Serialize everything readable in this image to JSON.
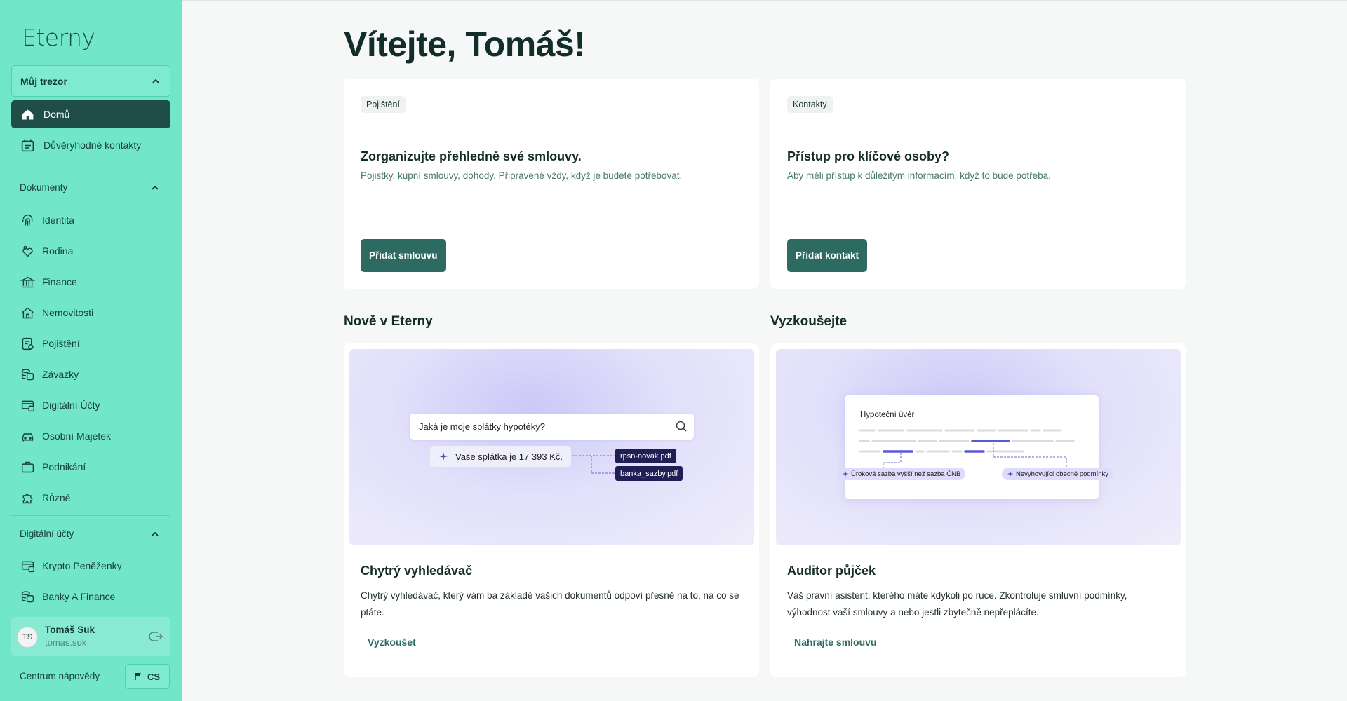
{
  "app": {
    "logo": "Eterny"
  },
  "sidebar": {
    "vault_label": "Můj trezor",
    "main_items": [
      {
        "label": "Domů",
        "icon": "home-icon",
        "active": true
      },
      {
        "label": "Důvěryhodné kontakty",
        "icon": "contacts-icon",
        "active": false
      }
    ],
    "documents_title": "Dokumenty",
    "documents": [
      {
        "label": "Identita",
        "icon": "fingerprint-icon"
      },
      {
        "label": "Rodina",
        "icon": "family-icon"
      },
      {
        "label": "Finance",
        "icon": "bank-icon"
      },
      {
        "label": "Nemovitosti",
        "icon": "house-icon"
      },
      {
        "label": "Pojištění",
        "icon": "insurance-icon"
      },
      {
        "label": "Závazky",
        "icon": "coins-icon"
      },
      {
        "label": "Digitální Účty",
        "icon": "digital-account-icon"
      },
      {
        "label": "Osobní Majetek",
        "icon": "car-icon"
      },
      {
        "label": "Podnikání",
        "icon": "briefcase-icon"
      },
      {
        "label": "Různé",
        "icon": "puzzle-icon"
      }
    ],
    "digital_title": "Digitální účty",
    "digital": [
      {
        "label": "Krypto Peněženky",
        "icon": "wallet-icon"
      },
      {
        "label": "Banky A Finance",
        "icon": "coins-icon"
      }
    ],
    "user": {
      "initials": "TS",
      "name": "Tomáš Suk",
      "handle": "tomas.suk"
    },
    "help_label": "Centrum nápovědy",
    "language": "CS"
  },
  "main": {
    "welcome": "Vítejte, Tomáš!",
    "cards": [
      {
        "badge": "Pojištění",
        "title": "Zorganizujte přehledně své smlouvy.",
        "description": "Pojistky, kupní smlouvy, dohody. Připravené vždy, když je budete potřebovat.",
        "button": "Přidat smlouvu"
      },
      {
        "badge": "Kontakty",
        "title": "Přístup pro klíčové osoby?",
        "description": "Aby měli přístup k důležitým informacím, když to bude potřeba.",
        "button": "Přidat kontakt"
      }
    ],
    "new_section_title": "Nově v Eterny",
    "try_section_title": "Vyzkoušejte",
    "features": [
      {
        "title": "Chytrý vyhledávač",
        "description": "Chytrý vyhledávač, který vám ba základě vašich dokumentů odpoví přesně na to, na co se ptáte.",
        "link": "Vyzkoušet",
        "illustration": {
          "search_query": "Jaká je moje splátky hypotéky?",
          "answer": "Vaše splátka je 17 393 Kč.",
          "files": [
            "rpsn-novak.pdf",
            "banka_sazby.pdf"
          ]
        }
      },
      {
        "title": "Auditor půjček",
        "description": "Váš právní asistent, kterého máte kdykoli po ruce. Zkontroluje smluvní podmínky, výhodnost vaší smlouvy a nebo jestli zbytečně nepřeplácíte.",
        "link": "Nahrajte smlouvu",
        "illustration": {
          "doc_title": "Hypoteční úvěr",
          "tags": [
            "Úroková sazba vyšší než sazba ČNB",
            "Nevyhovující obecné podmínky"
          ]
        }
      }
    ]
  },
  "colors": {
    "sidebar": "#72e6c9",
    "active_item": "#1e4e47",
    "primary_button": "#2d6b62",
    "illustration_accent": "#5b57d6"
  }
}
